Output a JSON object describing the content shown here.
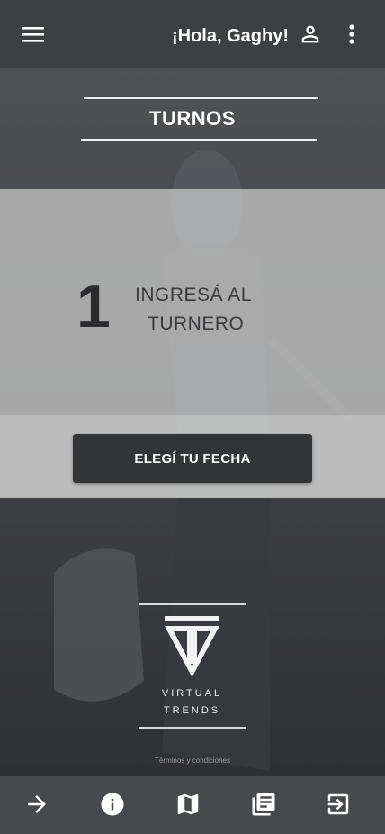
{
  "header": {
    "greeting": "¡Hola, Gaghy!",
    "icons": {
      "menu": "menu-icon",
      "user": "person-icon",
      "more": "more-vert-icon"
    }
  },
  "page": {
    "title": "TURNOS"
  },
  "step": {
    "number": "1",
    "text_line1": "INGRESÁ AL",
    "text_line2": "TURNERO",
    "cta_label": "ELEGÍ TU FECHA"
  },
  "brand": {
    "line1": "VIRTUAL",
    "line2": "TRENDS"
  },
  "footer": {
    "terms": "Términos y condiciones"
  },
  "bottom_nav": {
    "icons": [
      "arrow-right-icon",
      "info-icon",
      "map-icon",
      "library-books-icon",
      "exit-icon"
    ]
  },
  "colors": {
    "app_bar": "#3e3f42",
    "bottom_bar": "#48494c",
    "panel": "#c4c4c4",
    "button": "#333436",
    "text_light": "#ffffff",
    "text_dark": "#2c2c2e"
  }
}
